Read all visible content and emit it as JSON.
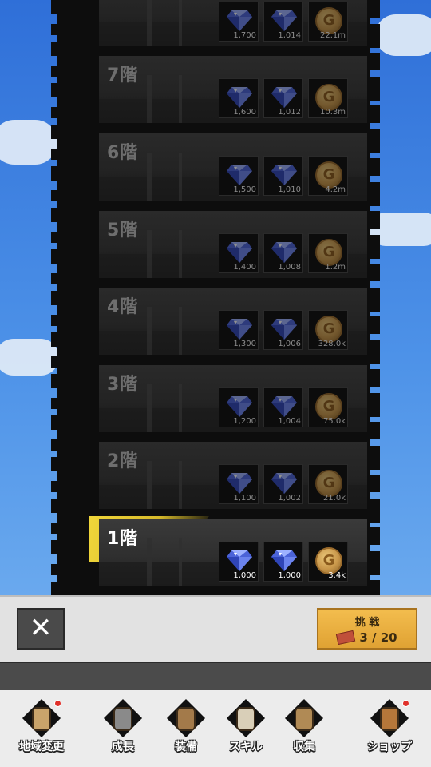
{
  "floors": [
    {
      "label": "",
      "rewards": [
        {
          "type": "gem",
          "amount": "1,700"
        },
        {
          "type": "gem",
          "amount": "1,014"
        },
        {
          "type": "coin",
          "amount": "22.1m"
        }
      ]
    },
    {
      "label": "7階",
      "rewards": [
        {
          "type": "gem",
          "amount": "1,600"
        },
        {
          "type": "gem",
          "amount": "1,012"
        },
        {
          "type": "coin",
          "amount": "10.3m"
        }
      ]
    },
    {
      "label": "6階",
      "rewards": [
        {
          "type": "gem",
          "amount": "1,500"
        },
        {
          "type": "gem",
          "amount": "1,010"
        },
        {
          "type": "coin",
          "amount": "4.2m"
        }
      ]
    },
    {
      "label": "5階",
      "rewards": [
        {
          "type": "gem",
          "amount": "1,400"
        },
        {
          "type": "gem",
          "amount": "1,008"
        },
        {
          "type": "coin",
          "amount": "1.2m"
        }
      ]
    },
    {
      "label": "4階",
      "rewards": [
        {
          "type": "gem",
          "amount": "1,300"
        },
        {
          "type": "gem",
          "amount": "1,006"
        },
        {
          "type": "coin",
          "amount": "328.0k"
        }
      ]
    },
    {
      "label": "3階",
      "rewards": [
        {
          "type": "gem",
          "amount": "1,200"
        },
        {
          "type": "gem",
          "amount": "1,004"
        },
        {
          "type": "coin",
          "amount": "75.0k"
        }
      ]
    },
    {
      "label": "2階",
      "rewards": [
        {
          "type": "gem",
          "amount": "1,100"
        },
        {
          "type": "gem",
          "amount": "1,002"
        },
        {
          "type": "coin",
          "amount": "21.0k"
        }
      ]
    },
    {
      "label": "1階",
      "rewards": [
        {
          "type": "gem",
          "amount": "1,000"
        },
        {
          "type": "gem",
          "amount": "1,000"
        },
        {
          "type": "coin",
          "amount": "3.4k"
        }
      ],
      "active": true
    }
  ],
  "coin_glyph": "G",
  "actions": {
    "close_glyph": "✕",
    "challenge_label": "挑 戦",
    "ticket_count": "3 / 20"
  },
  "nav": [
    {
      "label": "地域変更",
      "icon": "map-icon",
      "badge": true
    },
    {
      "label": "成長",
      "icon": "knight-helmet-icon",
      "badge": false
    },
    {
      "label": "装備",
      "icon": "backpack-icon",
      "badge": false
    },
    {
      "label": "スキル",
      "icon": "scroll-icon",
      "badge": false
    },
    {
      "label": "収集",
      "icon": "book-icon",
      "badge": false
    },
    {
      "label": "ショップ",
      "icon": "treasure-chest-icon",
      "badge": true
    }
  ],
  "colors": {
    "sky": "#3f7fd6",
    "highlight": "#f0d63a",
    "challenge_button": "#f3bd4e",
    "badge": "#e0312b"
  }
}
